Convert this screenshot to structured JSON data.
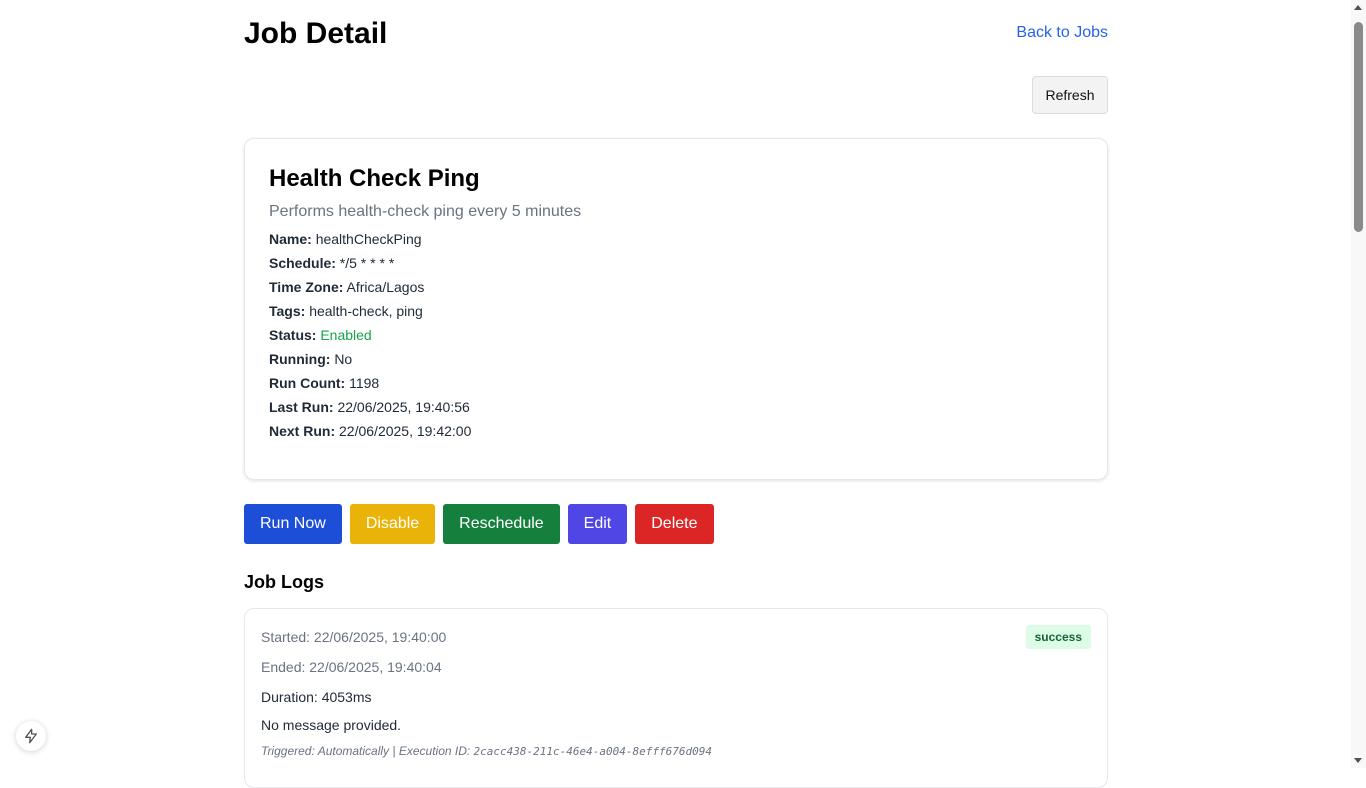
{
  "header": {
    "title": "Job Detail",
    "back_link": "Back to Jobs"
  },
  "toolbar": {
    "refresh_label": "Refresh"
  },
  "job": {
    "title": "Health Check Ping",
    "description": "Performs health-check ping every 5 minutes",
    "fields": [
      {
        "label": "Name:",
        "value": "healthCheckPing"
      },
      {
        "label": "Schedule:",
        "value": "*/5 * * * *"
      },
      {
        "label": "Time Zone:",
        "value": "Africa/Lagos"
      },
      {
        "label": "Tags:",
        "value": "health-check, ping"
      },
      {
        "label": "Status:",
        "value": "Enabled"
      },
      {
        "label": "Running:",
        "value": "No"
      },
      {
        "label": "Run Count:",
        "value": "1198"
      },
      {
        "label": "Last Run:",
        "value": "22/06/2025, 19:40:56"
      },
      {
        "label": "Next Run:",
        "value": "22/06/2025, 19:42:00"
      }
    ]
  },
  "actions": {
    "run_now": "Run Now",
    "disable": "Disable",
    "reschedule": "Reschedule",
    "edit": "Edit",
    "delete": "Delete"
  },
  "colors": {
    "run_now": "#1d4ed8",
    "disable": "#eab308",
    "reschedule": "#15803d",
    "edit": "#4f46e5",
    "delete": "#dc2626",
    "link": "#2563eb",
    "status_enabled": "#16a34a"
  },
  "logs": {
    "title": "Job Logs",
    "items": [
      {
        "started": "Started: 22/06/2025, 19:40:00",
        "ended": "Ended: 22/06/2025, 19:40:04",
        "duration": "Duration: 4053ms",
        "message": "No message provided.",
        "badge": "success",
        "triggered": "Triggered: Automatically | Execution ID: ",
        "execution_id": "2cacc438-211c-46e4-a004-8efff676d094"
      }
    ]
  },
  "icons": {
    "fab": "lightning-icon"
  }
}
